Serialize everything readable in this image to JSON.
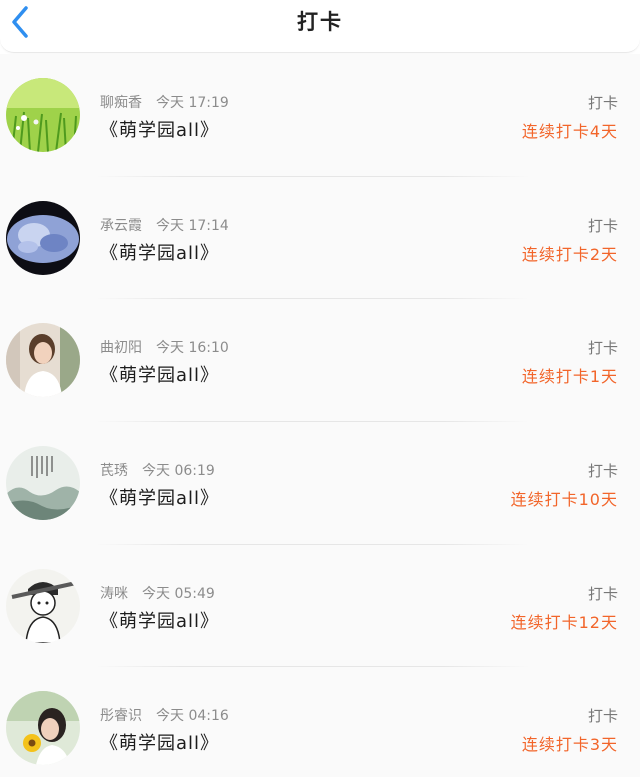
{
  "header": {
    "title": "打卡"
  },
  "colors": {
    "accent_back": "#2f8ff0",
    "streak": "#f2652a"
  },
  "items": [
    {
      "name": "聊痴香",
      "time": "今天 17:19",
      "title": "《萌学园all》",
      "action": "打卡",
      "streak": "连续打卡4天"
    },
    {
      "name": "承云霞",
      "time": "今天 17:14",
      "title": "《萌学园all》",
      "action": "打卡",
      "streak": "连续打卡2天"
    },
    {
      "name": "曲初阳",
      "time": "今天 16:10",
      "title": "《萌学园all》",
      "action": "打卡",
      "streak": "连续打卡1天"
    },
    {
      "name": "芪琇",
      "time": "今天 06:19",
      "title": "《萌学园all》",
      "action": "打卡",
      "streak": "连续打卡10天"
    },
    {
      "name": "涛咪",
      "time": "今天 05:49",
      "title": "《萌学园all》",
      "action": "打卡",
      "streak": "连续打卡12天"
    },
    {
      "name": "彤睿识",
      "time": "今天 04:16",
      "title": "《萌学园all》",
      "action": "打卡",
      "streak": "连续打卡3天"
    }
  ]
}
